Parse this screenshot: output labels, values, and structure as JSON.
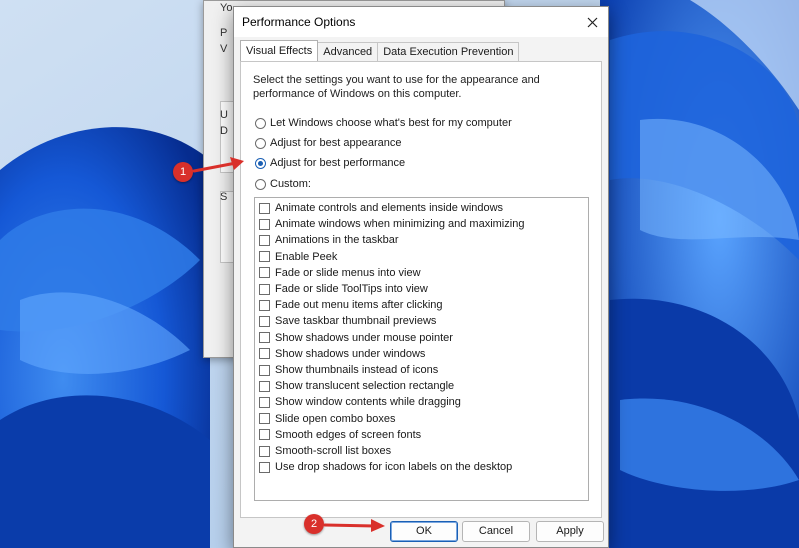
{
  "background_dialog": {
    "fragments": [
      "Yo",
      "P",
      "V",
      "U",
      "D",
      "S"
    ]
  },
  "dialog": {
    "title": "Performance Options",
    "tabs": [
      {
        "label": "Visual Effects",
        "active": true
      },
      {
        "label": "Advanced",
        "active": false
      },
      {
        "label": "Data Execution Prevention",
        "active": false
      }
    ],
    "description": "Select the settings you want to use for the appearance and performance of Windows on this computer.",
    "radios": [
      {
        "label": "Let Windows choose what's best for my computer",
        "checked": false
      },
      {
        "label": "Adjust for best appearance",
        "checked": false
      },
      {
        "label": "Adjust for best performance",
        "checked": true
      },
      {
        "label": "Custom:",
        "checked": false
      }
    ],
    "effects": [
      {
        "label": "Animate controls and elements inside windows",
        "checked": false
      },
      {
        "label": "Animate windows when minimizing and maximizing",
        "checked": false
      },
      {
        "label": "Animations in the taskbar",
        "checked": false
      },
      {
        "label": "Enable Peek",
        "checked": false
      },
      {
        "label": "Fade or slide menus into view",
        "checked": false
      },
      {
        "label": "Fade or slide ToolTips into view",
        "checked": false
      },
      {
        "label": "Fade out menu items after clicking",
        "checked": false
      },
      {
        "label": "Save taskbar thumbnail previews",
        "checked": false
      },
      {
        "label": "Show shadows under mouse pointer",
        "checked": false
      },
      {
        "label": "Show shadows under windows",
        "checked": false
      },
      {
        "label": "Show thumbnails instead of icons",
        "checked": false
      },
      {
        "label": "Show translucent selection rectangle",
        "checked": false
      },
      {
        "label": "Show window contents while dragging",
        "checked": false
      },
      {
        "label": "Slide open combo boxes",
        "checked": false
      },
      {
        "label": "Smooth edges of screen fonts",
        "checked": false
      },
      {
        "label": "Smooth-scroll list boxes",
        "checked": false
      },
      {
        "label": "Use drop shadows for icon labels on the desktop",
        "checked": false
      }
    ],
    "buttons": {
      "ok": "OK",
      "cancel": "Cancel",
      "apply": "Apply"
    }
  },
  "annotations": {
    "marker1": "1",
    "marker2": "2"
  },
  "colors": {
    "accent": "#1a5fb4",
    "marker": "#d9302b",
    "wallpaper": "#0a3fa8"
  },
  "icons": {
    "close": "close-icon",
    "arrow": "arrow-right-icon"
  }
}
